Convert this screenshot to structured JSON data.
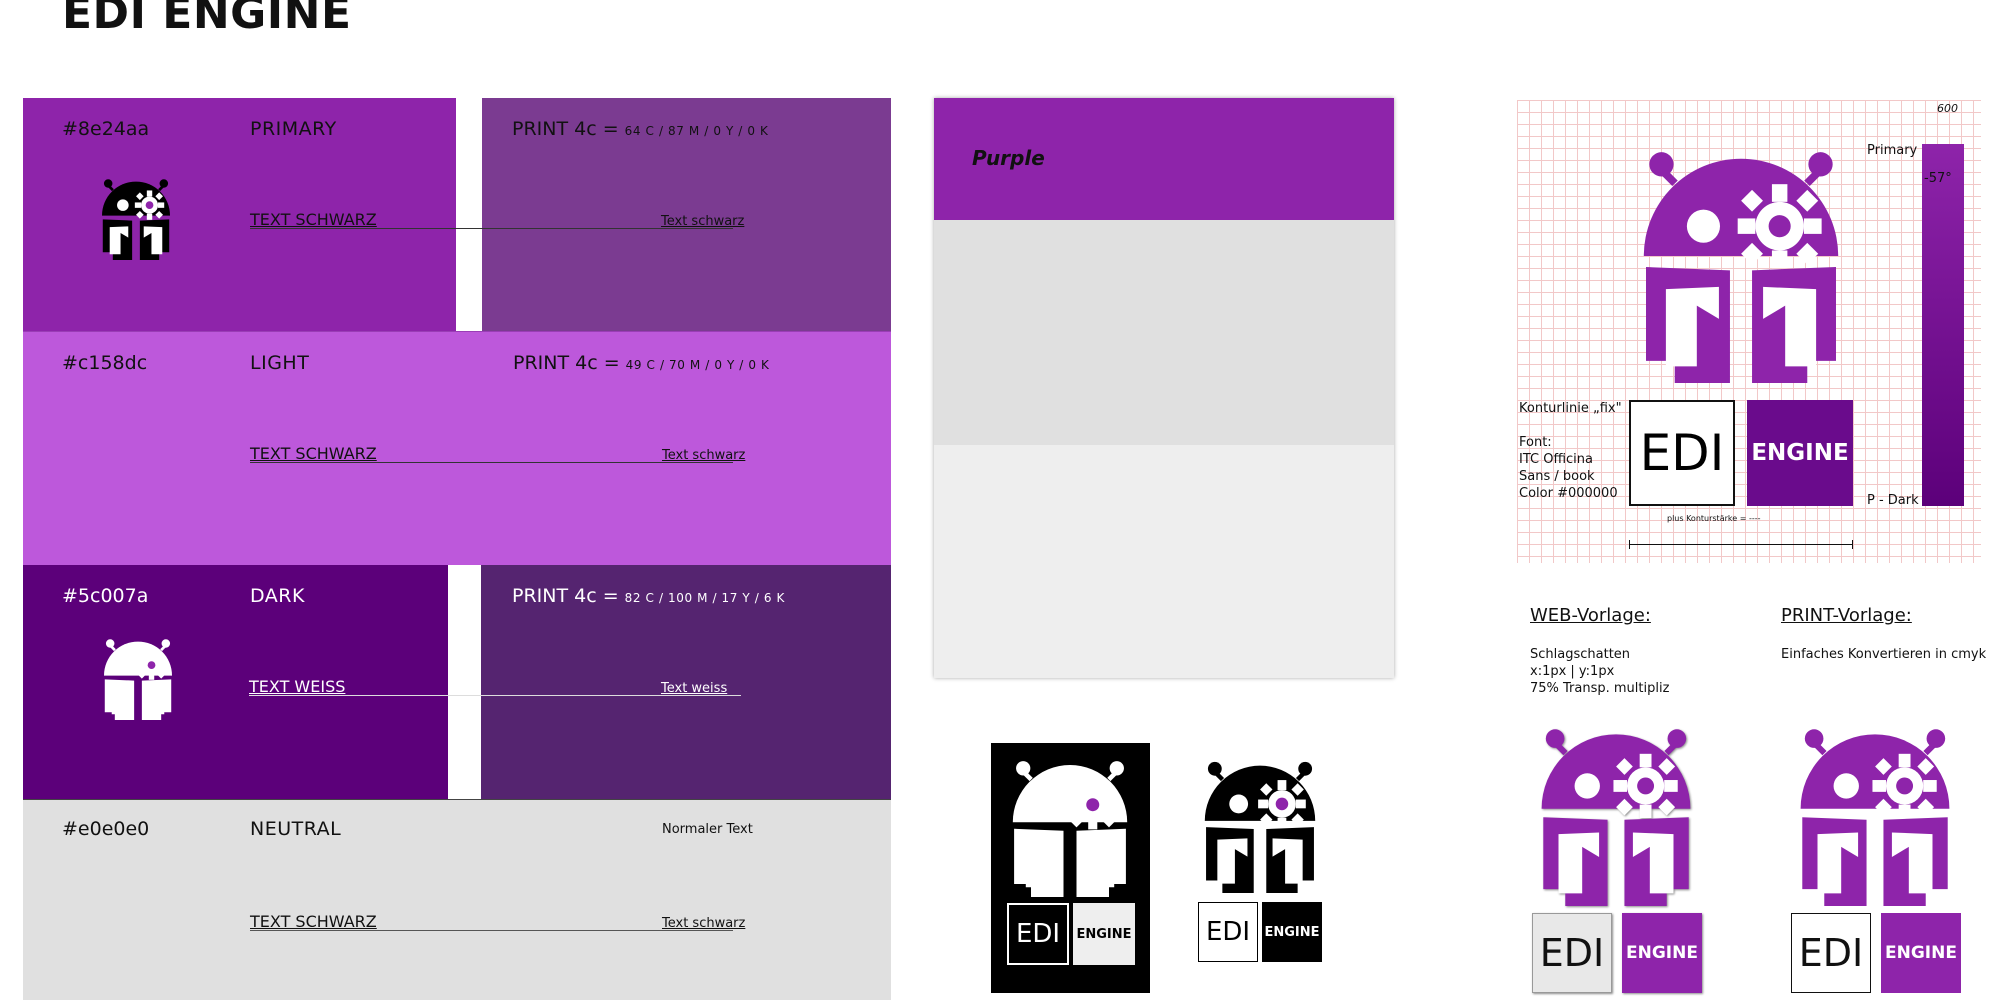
{
  "page": {
    "title": "EDI ENGINE"
  },
  "swatches": [
    {
      "hex": "#8e24aa",
      "name": "PRIMARY",
      "print_prefix": "PRINT 4c =",
      "print_values": "64 C / 87 M / 0 Y / 0 K",
      "text_label": "TEXT SCHWARZ",
      "text_small": "Text schwarz",
      "main_color": "#8e24aa",
      "print_color": "#7b3b91"
    },
    {
      "hex": "#c158dc",
      "name": "LIGHT",
      "print_prefix": "PRINT 4c =",
      "print_values": "49 C / 70 M / 0 Y / 0 K",
      "text_label": "TEXT SCHWARZ",
      "text_small": "Text schwarz",
      "main_color": "#bd58db"
    },
    {
      "hex": "#5c007a",
      "name": "DARK",
      "print_prefix": "PRINT 4c =",
      "print_values": "82 C / 100 M / 17 Y / 6 K",
      "text_label": "TEXT WEISS",
      "text_small": "Text weiss",
      "main_color": "#5c007a",
      "print_color": "#552470"
    },
    {
      "hex": "#e0e0e0",
      "name": "NEUTRAL",
      "text_top": "Normaler Text",
      "text_label": "TEXT SCHWARZ",
      "text_small": "Text schwarz",
      "main_color": "#e0e0e0"
    }
  ],
  "mockup": {
    "header_label": "Purple",
    "header_color": "#8e24aa",
    "mid_color": "#e0e0e0",
    "bottom_color": "#eeeeee"
  },
  "spec": {
    "grid_number": "600",
    "primary_label": "Primary",
    "angle_label": "-57°",
    "contour_label": "Konturlinie „fix\"",
    "font_lines": [
      "Font:",
      "ITC Officina",
      "Sans / book",
      "Color #000000"
    ],
    "dark_label": "P - Dark",
    "plus_label": "plus Konturstärke = ----",
    "logo_edi": "EDI",
    "logo_engine": "ENGINE"
  },
  "web_template": {
    "heading": "WEB-Vorlage:",
    "lines": [
      "Schlagschatten",
      "x:1px | y:1px",
      "75% Transp. multipliz"
    ]
  },
  "print_template": {
    "heading": "PRINT-Vorlage:",
    "lines": [
      "Einfaches Konvertieren in cmyk"
    ]
  },
  "colors": {
    "primary": "#8e24aa",
    "dark": "#5c007a",
    "black": "#000000",
    "white": "#ffffff"
  },
  "icons": [
    "robot-reader-logo-icon"
  ]
}
